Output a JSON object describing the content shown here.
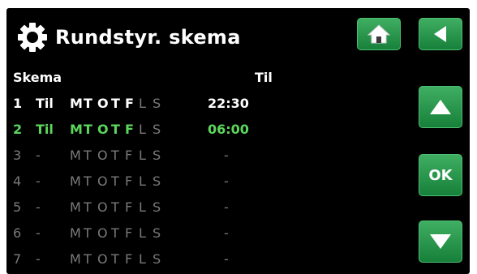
{
  "header": {
    "title": "Rundstyr. skema"
  },
  "columns": {
    "schedule": "Skema",
    "to": "Til"
  },
  "buttons": {
    "ok": "OK"
  },
  "rows": [
    {
      "num": "1",
      "mode": "Til",
      "days": [
        "M",
        "T",
        "O",
        "T",
        "F",
        "L",
        "S"
      ],
      "time": "22:30"
    },
    {
      "num": "2",
      "mode": "Til",
      "days": [
        "M",
        "T",
        "O",
        "T",
        "F",
        "L",
        "S"
      ],
      "time": "06:00"
    },
    {
      "num": "3",
      "mode": "-",
      "days": [
        "M",
        "T",
        "O",
        "T",
        "F",
        "L",
        "S"
      ],
      "time": "-"
    },
    {
      "num": "4",
      "mode": "-",
      "days": [
        "M",
        "T",
        "O",
        "T",
        "F",
        "L",
        "S"
      ],
      "time": "-"
    },
    {
      "num": "5",
      "mode": "-",
      "days": [
        "M",
        "T",
        "O",
        "T",
        "F",
        "L",
        "S"
      ],
      "time": "-"
    },
    {
      "num": "6",
      "mode": "-",
      "days": [
        "M",
        "T",
        "O",
        "T",
        "F",
        "L",
        "S"
      ],
      "time": "-"
    },
    {
      "num": "7",
      "mode": "-",
      "days": [
        "M",
        "T",
        "O",
        "T",
        "F",
        "L",
        "S"
      ],
      "time": "-"
    }
  ],
  "colors": {
    "active_green": "#5cd65c",
    "inactive_gray": "#7a7a7a",
    "button_green": "#17803a"
  },
  "icons": [
    "gear-icon",
    "home-icon",
    "back-arrow-icon",
    "up-arrow-icon",
    "down-arrow-icon"
  ]
}
